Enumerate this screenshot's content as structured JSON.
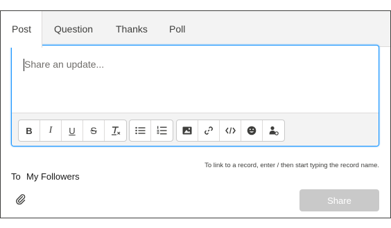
{
  "tabs": [
    {
      "label": "Post",
      "active": true
    },
    {
      "label": "Question",
      "active": false
    },
    {
      "label": "Thanks",
      "active": false
    },
    {
      "label": "Poll",
      "active": false
    }
  ],
  "editor": {
    "placeholder": "Share an update..."
  },
  "toolbar": {
    "text_format": [
      "bold-icon",
      "italic-icon",
      "underline-icon",
      "strikethrough-icon",
      "clear-formatting-icon"
    ],
    "lists": [
      "bulleted-list-icon",
      "numbered-list-icon"
    ],
    "insert": [
      "image-icon",
      "link-icon",
      "code-icon",
      "emoji-icon",
      "mention-icon"
    ],
    "bold_glyph": "B",
    "italic_glyph": "I",
    "underline_glyph": "U",
    "strike_glyph": "S"
  },
  "hint": "To link to a record, enter / then start typing the record name.",
  "audience": {
    "label": "To",
    "value": "My Followers"
  },
  "share_button": "Share",
  "colors": {
    "focus_border": "#1b96ff",
    "disabled_button": "#c9c9c9",
    "tab_bar": "#f3f3f3"
  }
}
